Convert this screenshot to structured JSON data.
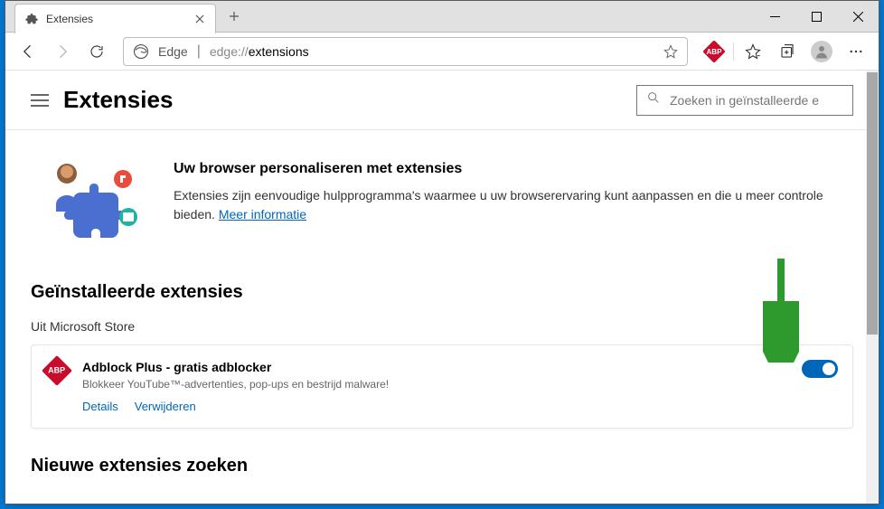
{
  "browser": {
    "tab_title": "Extensies",
    "address": {
      "prefix": "edge://",
      "path": "extensions",
      "engine_label": "Edge"
    }
  },
  "page": {
    "title": "Extensies",
    "search_placeholder": "Zoeken in geïnstalleerde e",
    "banner": {
      "heading": "Uw browser personaliseren met extensies",
      "body": "Extensies zijn eenvoudige hulpprogramma's waarmee u uw browserervaring kunt aanpassen en die u meer controle bieden. ",
      "link": "Meer informatie"
    },
    "sections": {
      "installed_heading": "Geïnstalleerde extensies",
      "store_label": "Uit Microsoft Store",
      "search_new_heading": "Nieuwe extensies zoeken"
    },
    "extension": {
      "name": "Adblock Plus - gratis adblocker",
      "desc": "Blokkeer YouTube™-advertenties, pop-ups en bestrijd malware!",
      "details": "Details",
      "remove": "Verwijderen",
      "icon_label": "ABP",
      "enabled": true
    }
  },
  "colors": {
    "accent": "#0067b8",
    "abp": "#c70d2c"
  }
}
